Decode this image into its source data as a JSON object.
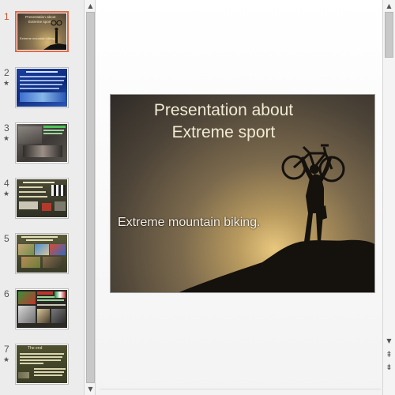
{
  "thumbnails": [
    {
      "number": "1",
      "active": true,
      "has_transition": false
    },
    {
      "number": "2",
      "active": false,
      "has_transition": true
    },
    {
      "number": "3",
      "active": false,
      "has_transition": true
    },
    {
      "number": "4",
      "active": false,
      "has_transition": true
    },
    {
      "number": "5",
      "active": false,
      "has_transition": false
    },
    {
      "number": "6",
      "active": false,
      "has_transition": false
    },
    {
      "number": "7",
      "active": false,
      "has_transition": true
    }
  ],
  "transition_icon": "star",
  "slide": {
    "title_line1": "Presentation about",
    "title_line2": "Extreme sport",
    "subtitle": "Extreme mountain biking."
  },
  "thumb_texts": {
    "t1_title1": "Presentation about",
    "t1_title2": "Extreme sport",
    "t1_sub": "Extreme mountain biking.",
    "t7_title": "The end"
  },
  "scroll_glyphs": {
    "up": "▲",
    "down": "▼",
    "prev_slide": "⇞",
    "next_slide": "⇟"
  },
  "colors": {
    "active_thumb_border": "#e06a48",
    "active_number": "#c5512b"
  }
}
